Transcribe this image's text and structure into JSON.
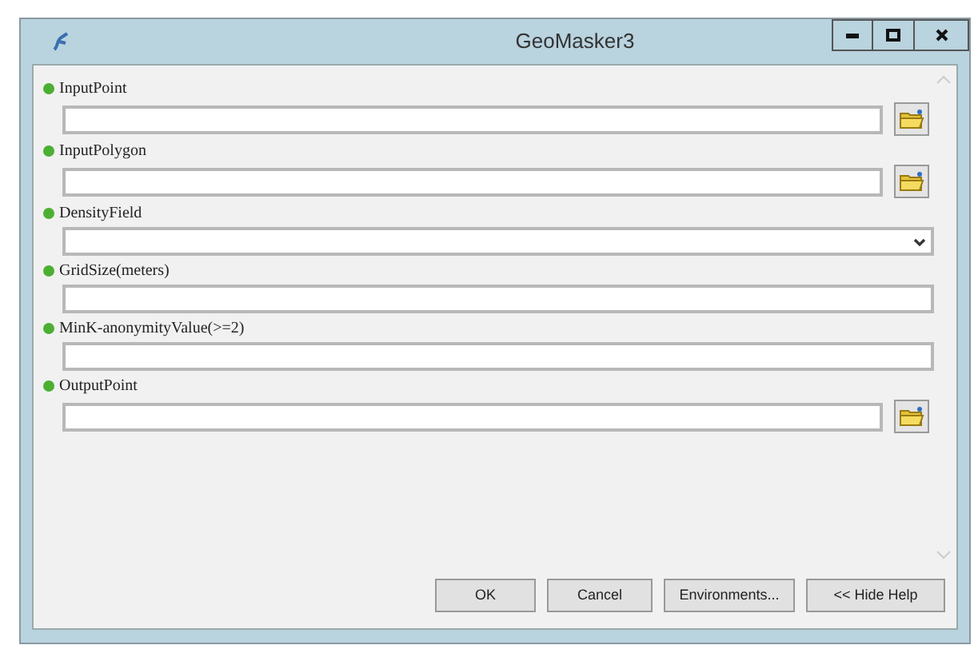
{
  "window": {
    "title": "GeoMasker3"
  },
  "parameters": [
    {
      "label": "InputPoint",
      "kind": "browse"
    },
    {
      "label": "InputPolygon",
      "kind": "browse"
    },
    {
      "label": "DensityField",
      "kind": "dropdown"
    },
    {
      "label": "GridSize(meters)",
      "kind": "text"
    },
    {
      "label": "MinK-anonymityValue(>=2)",
      "kind": "text"
    },
    {
      "label": "OutputPoint",
      "kind": "browse"
    }
  ],
  "buttons": [
    "OK",
    "Cancel",
    "Environments...",
    "<< Hide Help"
  ]
}
